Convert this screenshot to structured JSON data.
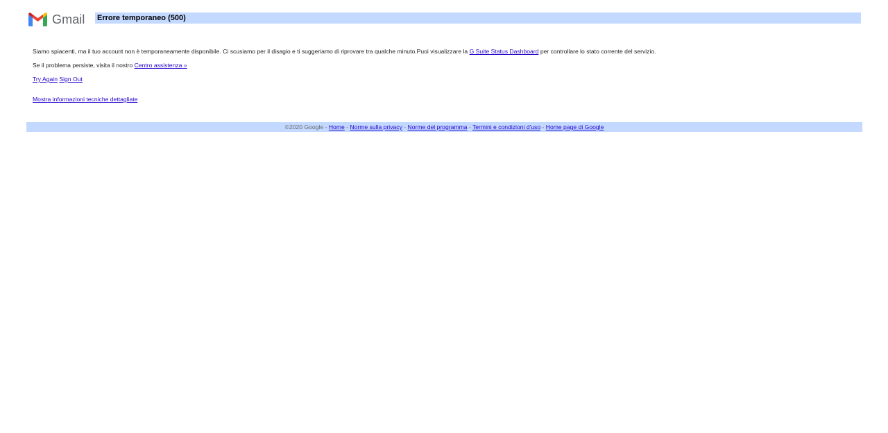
{
  "header": {
    "logo_text": "Gmail",
    "title": "Errore temporaneo (500)"
  },
  "message": {
    "line1_before": "Siamo spiacenti, ma il tuo account non è temporaneamente disponibile. Ci scusiamo per il disagio e ti suggeriamo di riprovare tra qualche minuto.Puoi visualizzare la ",
    "line1_link": "G Suite Status Dashboard",
    "line1_after": " per controllare lo stato corrente del servizio.",
    "line2_before": "Se il problema persiste, visita il nostro ",
    "line2_link": "Centro assistenza »"
  },
  "actions": {
    "try_again": "Try Again",
    "sign_out": "Sign Out",
    "details": "Mostra informazioni tecniche dettagliate"
  },
  "footer": {
    "copyright": "©2020 Google",
    "separator": " - ",
    "links": [
      "Home",
      "Norme sulla privacy",
      "Norme del programma",
      "Termini e condizioni d'uso",
      "Home page di Google"
    ]
  },
  "colors": {
    "bar_background": "#c3d9ff",
    "link": "#2200cc",
    "gmail_red": "#ea4335",
    "gmail_blue": "#4285f4",
    "gmail_green": "#34a853",
    "gmail_yellow": "#fbbc04",
    "gmail_dark_red": "#c5221f"
  },
  "icons": {
    "logo": "gmail-m-logo-icon"
  }
}
